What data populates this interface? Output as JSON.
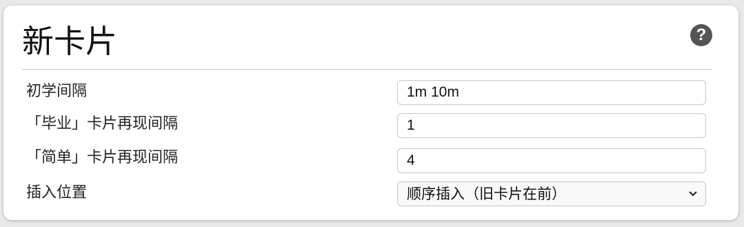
{
  "section": {
    "title": "新卡片",
    "help_icon": "question-circle-icon",
    "help_glyph": "?"
  },
  "rows": {
    "learning_steps": {
      "label": "初学间隔",
      "value": "1m 10m"
    },
    "graduating_interval": {
      "label": "「毕业」卡片再现间隔",
      "value": "1"
    },
    "easy_interval": {
      "label": "「简单」卡片再现间隔",
      "value": "4"
    },
    "insertion_order": {
      "label": "插入位置",
      "value": "顺序插入（旧卡片在前）"
    }
  },
  "colors": {
    "background": "#e9e9e9",
    "card": "#ffffff",
    "help_icon": "#555555",
    "border": "#c6c6c6"
  }
}
